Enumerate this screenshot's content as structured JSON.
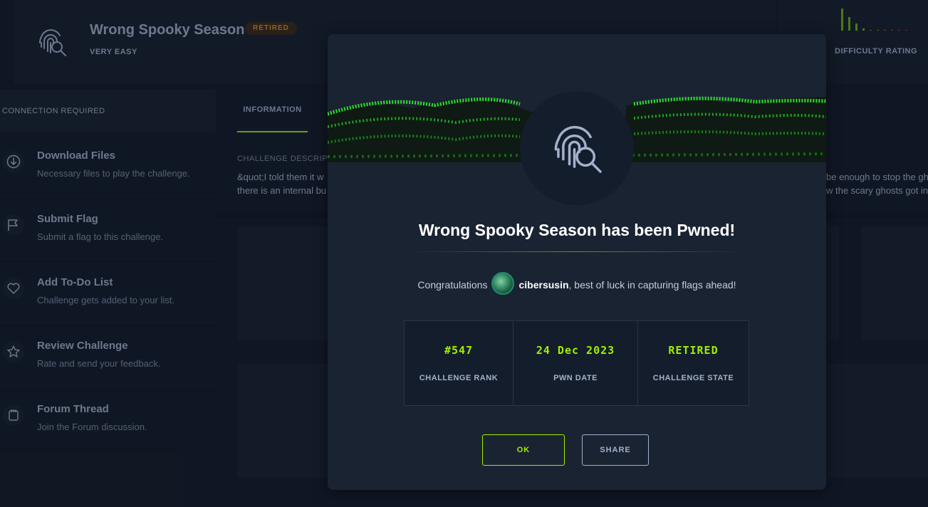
{
  "challenge": {
    "title": "Wrong Spooky Season",
    "status_badge": "RETIRED",
    "difficulty": "VERY EASY",
    "difficulty_rating_label": "DIFFICULTY RATING",
    "icon": "fingerprint-search-icon"
  },
  "sidebar": {
    "connection": "CONNECTION REQUIRED",
    "items": [
      {
        "title": "Download Files",
        "subtitle": "Necessary files to play the challenge.",
        "icon": "download-icon"
      },
      {
        "title": "Submit Flag",
        "subtitle": "Submit a flag to this challenge.",
        "icon": "flag-icon"
      },
      {
        "title": "Add To-Do List",
        "subtitle": "Challenge gets added to your list.",
        "icon": "heart-icon"
      },
      {
        "title": "Review Challenge",
        "subtitle": "Rate and send your feedback.",
        "icon": "star-icon"
      },
      {
        "title": "Forum Thread",
        "subtitle": "Join the Forum discussion.",
        "icon": "forum-icon"
      }
    ]
  },
  "main": {
    "tab": "INFORMATION",
    "description_label": "CHALLENGE DESCRIPT",
    "description_left": [
      "&quot;I told them it w",
      "there is an internal bu"
    ],
    "description_right": [
      "be enough to stop the gh",
      "w the scary ghosts got in"
    ]
  },
  "modal": {
    "title": "Wrong Spooky Season has been Pwned!",
    "congrats_prefix": "Congratulations",
    "username": "cibersusin",
    "congrats_suffix": ", best of luck in capturing flags ahead!",
    "stats": [
      {
        "value": "#547",
        "label": "CHALLENGE RANK"
      },
      {
        "value": "24 Dec 2023",
        "label": "PWN DATE"
      },
      {
        "value": "RETIRED",
        "label": "CHALLENGE STATE"
      }
    ],
    "ok_label": "OK",
    "share_label": "SHARE"
  },
  "colors": {
    "accent_green": "#9fef00",
    "retired_orange": "#d39024",
    "background": "#141d2b",
    "panel": "#1a2332"
  }
}
